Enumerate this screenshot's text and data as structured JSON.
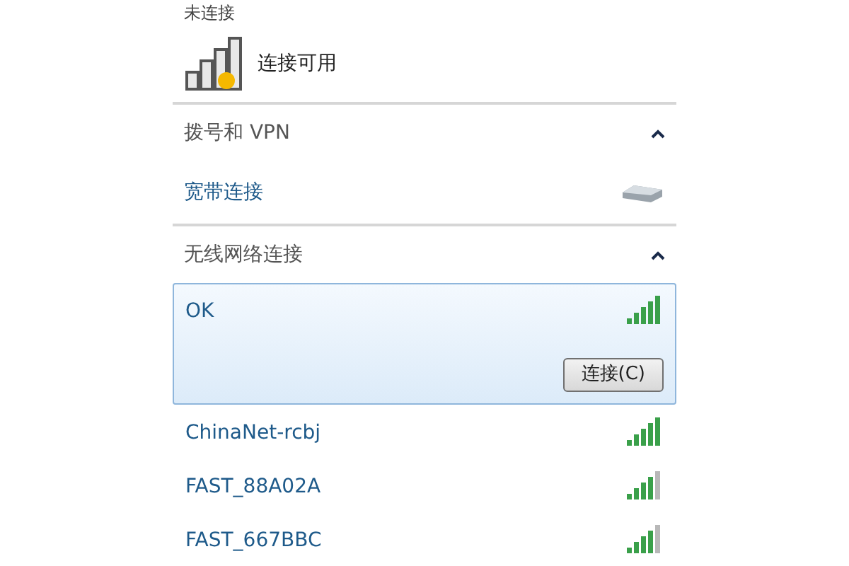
{
  "status": {
    "title": "未连接",
    "text": "连接可用"
  },
  "sections": [
    {
      "title": "拨号和 VPN",
      "expanded": true,
      "items": [
        {
          "kind": "dialup",
          "name": "宽带连接"
        }
      ]
    },
    {
      "title": "无线网络连接",
      "expanded": true,
      "items": [
        {
          "kind": "wifi",
          "name": "OK",
          "selected": true,
          "full_signal": true,
          "button": "连接(C)"
        },
        {
          "kind": "wifi",
          "name": "ChinaNet-rcbj",
          "selected": false,
          "full_signal": true
        },
        {
          "kind": "wifi",
          "name": "FAST_88A02A",
          "selected": false,
          "full_signal": false
        },
        {
          "kind": "wifi",
          "name": "FAST_667BBC",
          "selected": false,
          "full_signal": false
        }
      ]
    }
  ]
}
